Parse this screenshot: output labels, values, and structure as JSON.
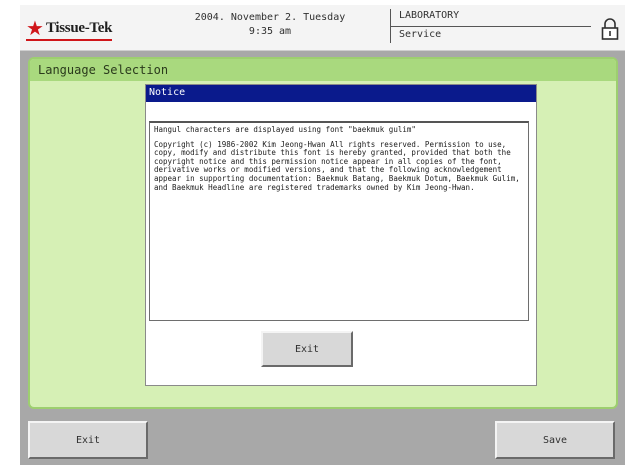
{
  "header": {
    "brand": "Tissue-Tek",
    "brand_color": "#d0161a",
    "date_line": "2004. November 2. Tuesday",
    "time_line": "9:35 am",
    "location": "LABORATORY",
    "mode": "Service",
    "lock_icon": "padlock-icon"
  },
  "panel": {
    "title": "Language Selection"
  },
  "dialog": {
    "title": "Notice",
    "title_bar_color": "#0a1a8c",
    "paragraph1": "Hangul characters are displayed using font \"baekmuk gulim\"",
    "paragraph2": "Copyright (c) 1986-2002 Kim Jeong-Hwan All rights reserved. Permission to use, copy, modify and distribute this font is hereby granted, provided that both the copyright notice and this permission notice appear in all copies of the font, derivative works or modified versions, and that the following acknowledgement appear in supporting documentation: Baekmuk Batang, Baekmuk Dotum, Baekmuk Gulim, and Baekmuk Headline are registered trademarks owned by Kim Jeong-Hwan.",
    "exit_label": "Exit"
  },
  "footer": {
    "exit_label": "Exit",
    "save_label": "Save"
  }
}
